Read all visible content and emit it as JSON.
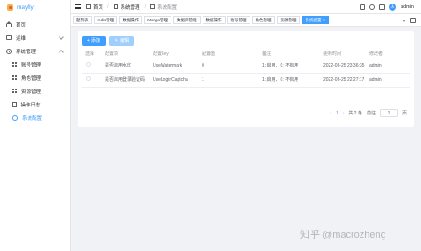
{
  "app": {
    "name": "mayfly"
  },
  "sidebar": {
    "items": [
      {
        "label": "首页",
        "icon": "home-icon"
      },
      {
        "label": "运维",
        "icon": "monitor-icon",
        "expandable": true
      },
      {
        "label": "系统管理",
        "icon": "gear-icon",
        "expandable": true,
        "expanded": true
      }
    ],
    "sub_items": [
      {
        "label": "账号管理",
        "icon": "grid-icon"
      },
      {
        "label": "角色管理",
        "icon": "grid-icon"
      },
      {
        "label": "资源管理",
        "icon": "grid-icon"
      },
      {
        "label": "操作日志",
        "icon": "document-icon"
      },
      {
        "label": "系统配置",
        "icon": "settings-icon",
        "active": true
      }
    ]
  },
  "header": {
    "breadcrumb": [
      "首页",
      "系统管理",
      "系统配置"
    ],
    "user": {
      "avatar": "A",
      "name": "admin"
    }
  },
  "tags": [
    {
      "label": "题列表"
    },
    {
      "label": "redis管理"
    },
    {
      "label": "数据操作"
    },
    {
      "label": "Mongo管理"
    },
    {
      "label": "数据库管理"
    },
    {
      "label": "数据操作"
    },
    {
      "label": "账号管理"
    },
    {
      "label": "角色管理"
    },
    {
      "label": "资源管理"
    },
    {
      "label": "系统配置",
      "active": true,
      "closable": true
    }
  ],
  "toolbar": {
    "add_label": "添加",
    "edit_label": "编辑"
  },
  "table": {
    "columns": [
      "选择",
      "配置项",
      "配置key",
      "配置值",
      "备注",
      "更新时间",
      "修改者"
    ],
    "rows": [
      {
        "name": "是否启用水印",
        "key": "UseWatermark",
        "value": "0",
        "remark": "1: 启用、0: 不启用",
        "updated": "2022-08-25 23:36:35",
        "modifier": "admin"
      },
      {
        "name": "是否启用登录验证码",
        "key": "UseLoginCaptcha",
        "value": "1",
        "remark": "1: 启用、0: 不启用",
        "updated": "2022-08-25 22:27:17",
        "modifier": "admin"
      }
    ]
  },
  "pagination": {
    "current": "1",
    "total_text": "共 2 条",
    "jump_label": "前往",
    "page_input": "1",
    "page_suffix": "页"
  },
  "watermark": "知乎 @macrozheng",
  "colors": {
    "primary": "#409eff",
    "primary_disabled": "#a0cfff",
    "sidebar_bg": "#ffffff",
    "page_bg": "#f0f2f5"
  }
}
